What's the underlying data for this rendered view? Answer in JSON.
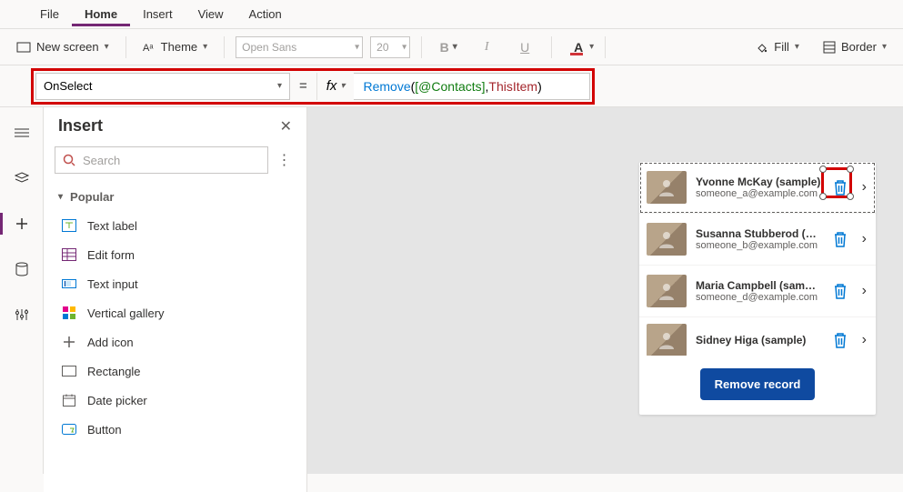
{
  "menu": {
    "items": [
      "File",
      "Home",
      "Insert",
      "View",
      "Action"
    ],
    "active": "Home"
  },
  "ribbon": {
    "new_screen": "New screen",
    "theme": "Theme",
    "font": "Open Sans",
    "size": "20",
    "bold": "B",
    "italic": "I",
    "underline": "U",
    "font_color": "A",
    "fill": "Fill",
    "border": "Border"
  },
  "formula_bar": {
    "property": "OnSelect",
    "fx": "fx",
    "tokens": {
      "func": "Remove",
      "open": "( ",
      "ds": "[@Contacts]",
      "sep": ", ",
      "kw": "ThisItem",
      "close": " )"
    }
  },
  "insert_pane": {
    "title": "Insert",
    "search_placeholder": "Search",
    "category": "Popular",
    "items": [
      {
        "label": "Text label",
        "icon": "text-label-icon"
      },
      {
        "label": "Edit form",
        "icon": "edit-form-icon"
      },
      {
        "label": "Text input",
        "icon": "text-input-icon"
      },
      {
        "label": "Vertical gallery",
        "icon": "vertical-gallery-icon"
      },
      {
        "label": "Add icon",
        "icon": "add-icon-icon"
      },
      {
        "label": "Rectangle",
        "icon": "rectangle-icon"
      },
      {
        "label": "Date picker",
        "icon": "date-picker-icon"
      },
      {
        "label": "Button",
        "icon": "button-icon"
      }
    ]
  },
  "gallery": {
    "remove_label": "Remove record",
    "contacts": [
      {
        "name": "Yvonne McKay (sample)",
        "email": "someone_a@example.com",
        "selected": true
      },
      {
        "name": "Susanna Stubberod (sample)",
        "email": "someone_b@example.com"
      },
      {
        "name": "Maria Campbell (sample)",
        "email": "someone_d@example.com"
      },
      {
        "name": "Sidney Higa (sample)",
        "email": ""
      }
    ]
  }
}
